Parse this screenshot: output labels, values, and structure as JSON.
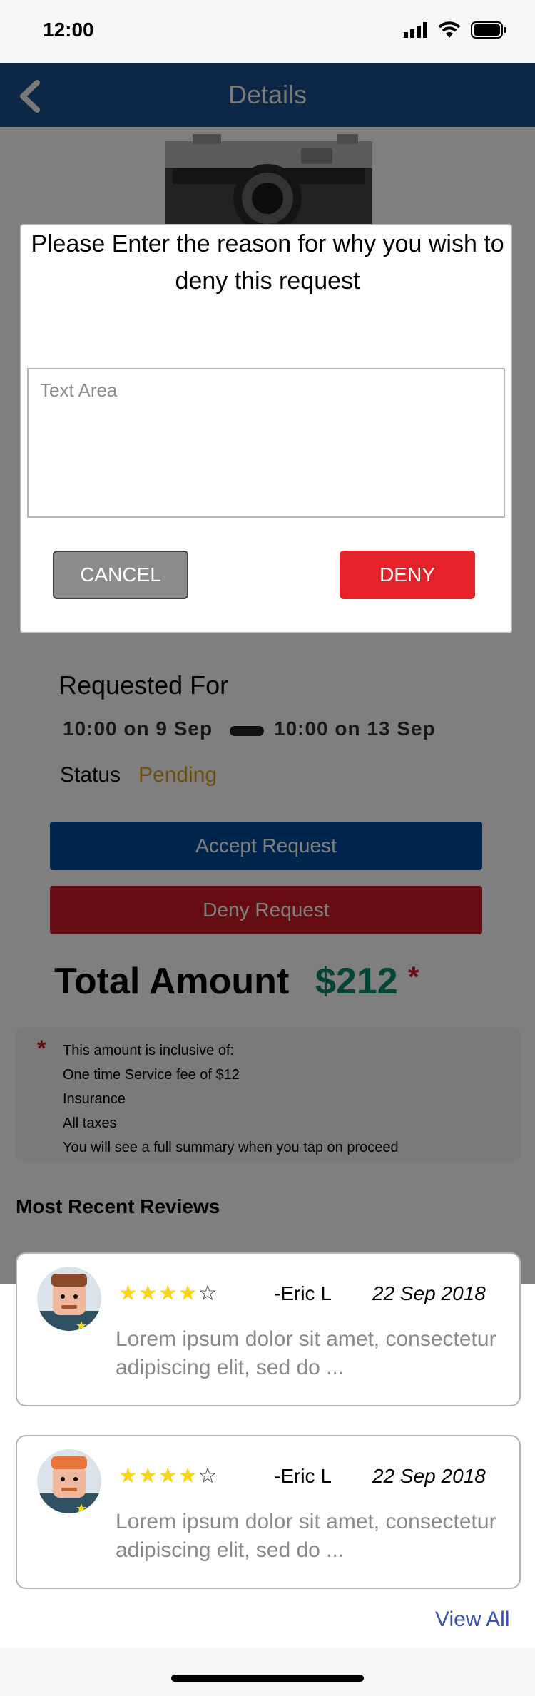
{
  "status_bar": {
    "time": "12:00"
  },
  "nav": {
    "title": "Details",
    "back_icon": "chevron-left-icon"
  },
  "request": {
    "requested_for_label": "Requested For",
    "from": "10:00 on 9 Sep",
    "to": "10:00 on 13 Sep",
    "status_label": "Status",
    "status_value": "Pending",
    "status_color": "#e59d18"
  },
  "actions": {
    "accept_label": "Accept Request",
    "deny_label": "Deny Request"
  },
  "total": {
    "label": "Total Amount",
    "value": "$212",
    "asterisk": "*"
  },
  "fees": {
    "asterisk": "*",
    "lines": [
      "This amount is inclusive of:",
      "One time Service fee of $12",
      "Insurance",
      "All taxes",
      "You will see a full summary when you tap on proceed"
    ]
  },
  "reviews": {
    "title": "Most Recent Reviews",
    "items": [
      {
        "rating": 4,
        "max": 5,
        "author": "-Eric L",
        "date": "22 Sep 2018",
        "text": "Lorem ipsum dolor sit amet, consectetur adipiscing elit, sed do ..."
      },
      {
        "rating": 4,
        "max": 5,
        "author": "-Eric L",
        "date": "22 Sep 2018",
        "text": "Lorem ipsum dolor sit amet, consectetur adipiscing elit, sed do ..."
      }
    ],
    "view_all_label": "View All"
  },
  "dialog": {
    "message": "Please Enter the reason for why you wish to deny this request",
    "textarea_placeholder": "Text Area",
    "textarea_value": "",
    "cancel_label": "CANCEL",
    "deny_label": "DENY"
  },
  "colors": {
    "nav": "#1a4e8c",
    "accept": "#004a99",
    "deny": "#e52129",
    "total_value": "#0c8a6a",
    "link": "#3a4fb3",
    "star": "#f7d417"
  }
}
